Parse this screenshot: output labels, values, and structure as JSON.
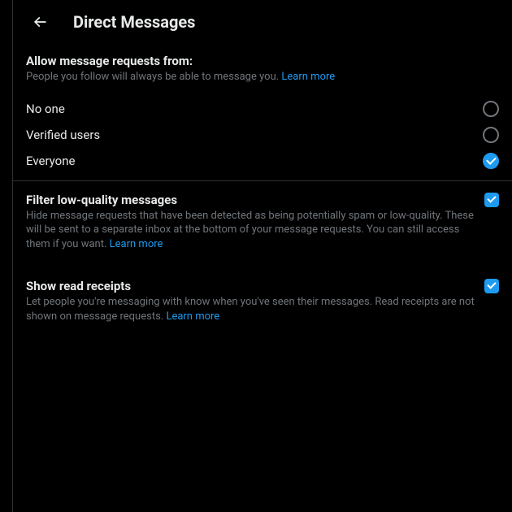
{
  "header": {
    "title": "Direct Messages"
  },
  "allowSection": {
    "title": "Allow message requests from:",
    "desc": "People you follow will always be able to message you.",
    "learnMore": "Learn more",
    "options": {
      "noone": "No one",
      "verified": "Verified users",
      "everyone": "Everyone"
    },
    "selected": "everyone"
  },
  "filterSection": {
    "title": "Filter low-quality messages",
    "desc": "Hide message requests that have been detected as being potentially spam or low-quality. These will be sent to a separate inbox at the bottom of your message requests. You can still access them if you want.",
    "learnMore": "Learn more",
    "checked": true
  },
  "receiptsSection": {
    "title": "Show read receipts",
    "desc": "Let people you're messaging with know when you've seen their messages. Read receipts are not shown on message requests.",
    "learnMore": "Learn more",
    "checked": true
  }
}
